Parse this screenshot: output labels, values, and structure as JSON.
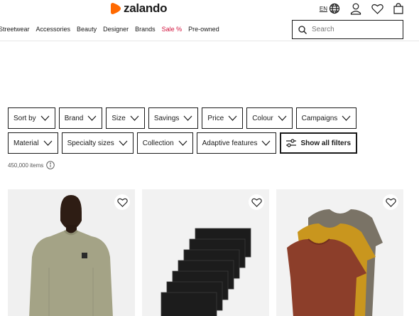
{
  "header": {
    "brand": "zalando",
    "language": "EN",
    "icons": [
      "globe-icon",
      "user-icon",
      "heart-icon",
      "bag-icon"
    ]
  },
  "nav": {
    "items": [
      {
        "label": "Streetwear"
      },
      {
        "label": "Accessories"
      },
      {
        "label": "Beauty"
      },
      {
        "label": "Designer"
      },
      {
        "label": "Brands"
      },
      {
        "label": "Sale %"
      },
      {
        "label": "Pre-owned"
      }
    ]
  },
  "search": {
    "placeholder": "Search"
  },
  "filters": {
    "row1": [
      "Sort by",
      "Brand",
      "Size",
      "Savings",
      "Price",
      "Colour",
      "Campaigns"
    ],
    "row2": [
      "Material",
      "Specialty sizes",
      "Collection",
      "Adaptive features"
    ],
    "show_all": "Show all filters"
  },
  "results": {
    "count": "450,000 items"
  },
  "colors": {
    "brand_orange": "#ff6900",
    "sale_red": "#d0103a"
  }
}
